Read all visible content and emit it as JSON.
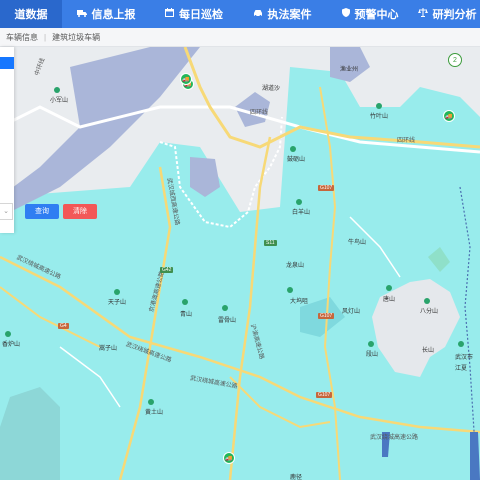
{
  "nav": {
    "items": [
      {
        "label": "道数据",
        "icon": "data-icon"
      },
      {
        "label": "信息上报",
        "icon": "truck-icon"
      },
      {
        "label": "每日巡检",
        "icon": "calendar-icon"
      },
      {
        "label": "执法案件",
        "icon": "car-icon"
      },
      {
        "label": "预警中心",
        "icon": "shield-icon"
      },
      {
        "label": "研判分析",
        "icon": "scale-icon"
      }
    ],
    "active_index": 0
  },
  "breadcrumb": [
    "车辆信息",
    "建筑垃圾车辆"
  ],
  "panel": {
    "query_label": "查询",
    "clear_label": "清除",
    "select_caret": "⌄"
  },
  "map": {
    "badge_count": "2",
    "labels": {
      "xiaojunshan": "小军山",
      "zhuyeshan": "竹叶山",
      "yuyezhou": "渔业州",
      "hudaosha": "湖道沙",
      "dongyoushan": "鼓砺山",
      "baiqishan": "白羊山",
      "niuwushan": "牛鸟山",
      "longqiuan": "龙泉山",
      "bagongshan": "八分山",
      "fengdengshan": "风灯山",
      "tangshanp": "唐山",
      "dawuzuan": "大坞咀",
      "duanshan": "段山",
      "changshanshan": "长山",
      "qingshan": "青山",
      "tianzishan": "天子山",
      "dongrunshan": "雷骨山",
      "jiaozishan": "嵩子山",
      "huangtushan": "黄土山",
      "xiangluoshan": "香炉山",
      "luqiao": "鹿径",
      "wuhanshi": "武汉市",
      "jiedao": "江夏"
    },
    "roads": {
      "siring_n": "四环线",
      "siring_e": "四环线",
      "zhangjin": "中环线",
      "wh_lake1": "武汉绕城高速公路",
      "wh_lake2": "武汉绕城高速公路",
      "wh_lake3": "武汉绕城高速公路",
      "wh_south": "武汉绕城高速公路",
      "jingguang": "京港澳高速公路",
      "hubei": "沪渝高速公路",
      "wuhanjing": "武汉城西高速公路"
    },
    "shields": [
      "G107",
      "G107",
      "S11",
      "G107",
      "G4",
      "G42"
    ]
  }
}
